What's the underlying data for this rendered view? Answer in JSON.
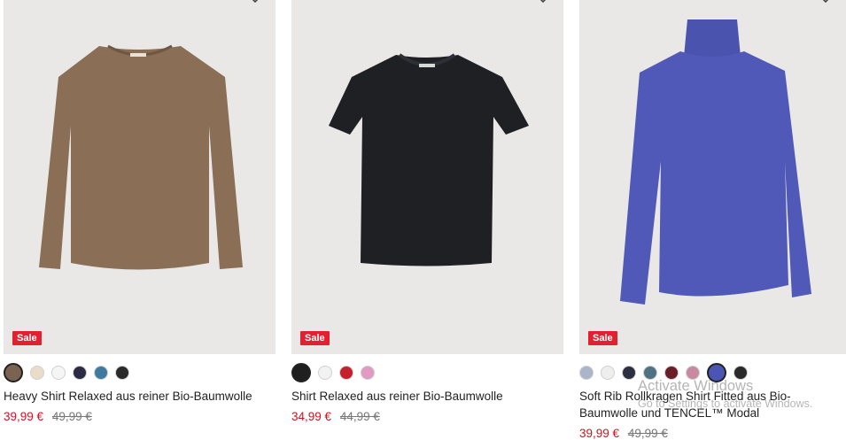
{
  "products": [
    {
      "name": "Heavy Shirt Relaxed aus reiner Bio-Baumwolle",
      "sale_badge": "Sale",
      "price_sale": "39,99 €",
      "price_old": "49,99 €",
      "swatches": [
        "#7a6350",
        "#e9dcc8",
        "#f5f5f5",
        "#2b2b46",
        "#3f7b9e",
        "#2a2a2a"
      ],
      "selected_swatch": 0,
      "garment": "long-sleeve",
      "garment_color": "#8a6e55"
    },
    {
      "name": "Shirt Relaxed aus reiner Bio-Baumwolle",
      "sale_badge": "Sale",
      "price_sale": "34,99 €",
      "price_old": "44,99 €",
      "swatches": [
        "#1f1f1f",
        "#f2f2f2",
        "#c4202d",
        "#e29ac2"
      ],
      "selected_swatch": 0,
      "garment": "tshirt",
      "garment_color": "#1e2024"
    },
    {
      "name": "Soft Rib Rollkragen Shirt Fitted aus Bio-Baumwolle und TENCEL™ Modal",
      "sale_badge": "Sale",
      "price_sale": "39,99 €",
      "price_old": "49,99 €",
      "swatches": [
        "#aab5c8",
        "#eeeeee",
        "#2c2f3f",
        "#4f7382",
        "#6a1e2a",
        "#c98aa1",
        "#4b55b4",
        "#2a2a2a"
      ],
      "selected_swatch": 6,
      "garment": "turtleneck",
      "garment_color": "#5059b8"
    }
  ],
  "watermark": {
    "line1": "Activate Windows",
    "line2": "Go to Settings to activate Windows."
  }
}
